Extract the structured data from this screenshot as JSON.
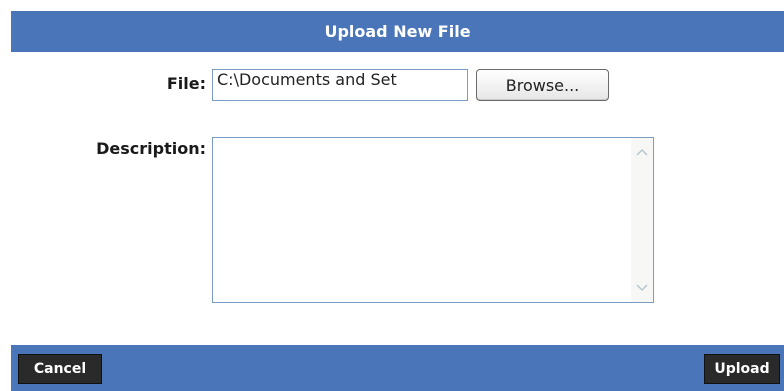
{
  "dialog": {
    "title": "Upload New File"
  },
  "form": {
    "file_label": "File:",
    "file_value": "C:\\Documents and Set",
    "browse_label": "Browse...",
    "description_label": "Description:",
    "description_value": ""
  },
  "footer": {
    "cancel_label": "Cancel",
    "upload_label": "Upload"
  },
  "colors": {
    "bar": "#4a76b9",
    "footer_button": "#2a2a2a"
  }
}
